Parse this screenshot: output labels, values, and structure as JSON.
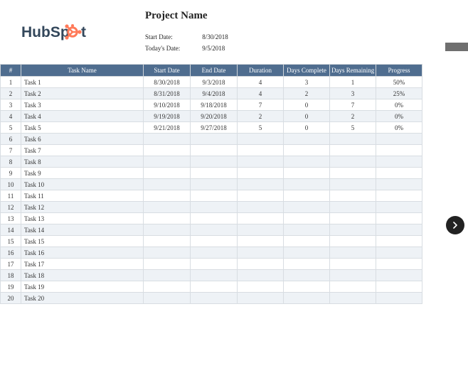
{
  "logo": {
    "text_primary": "HubSp",
    "text_secondary": "t"
  },
  "project": {
    "title": "Project Name",
    "start_date_label": "Start Date:",
    "start_date_value": "8/30/2018",
    "today_label": "Today's Date:",
    "today_value": "9/5/2018"
  },
  "table": {
    "headers": {
      "num": "#",
      "name": "Task Name",
      "start": "Start Date",
      "end": "End Date",
      "duration": "Duration",
      "days_complete": "Days Complete",
      "days_remaining": "Days Remaining",
      "progress": "Progress"
    },
    "rows": [
      {
        "n": "1",
        "name": "Task 1",
        "start": "8/30/2018",
        "end": "9/3/2018",
        "dur": "4",
        "dc": "3",
        "dr": "1",
        "prog": "50%"
      },
      {
        "n": "2",
        "name": "Task 2",
        "start": "8/31/2018",
        "end": "9/4/2018",
        "dur": "4",
        "dc": "2",
        "dr": "3",
        "prog": "25%"
      },
      {
        "n": "3",
        "name": "Task 3",
        "start": "9/10/2018",
        "end": "9/18/2018",
        "dur": "7",
        "dc": "0",
        "dr": "7",
        "prog": "0%"
      },
      {
        "n": "4",
        "name": "Task 4",
        "start": "9/19/2018",
        "end": "9/20/2018",
        "dur": "2",
        "dc": "0",
        "dr": "2",
        "prog": "0%"
      },
      {
        "n": "5",
        "name": "Task 5",
        "start": "9/21/2018",
        "end": "9/27/2018",
        "dur": "5",
        "dc": "0",
        "dr": "5",
        "prog": "0%"
      },
      {
        "n": "6",
        "name": "Task 6",
        "start": "",
        "end": "",
        "dur": "",
        "dc": "",
        "dr": "",
        "prog": ""
      },
      {
        "n": "7",
        "name": "Task 7",
        "start": "",
        "end": "",
        "dur": "",
        "dc": "",
        "dr": "",
        "prog": ""
      },
      {
        "n": "8",
        "name": "Task 8",
        "start": "",
        "end": "",
        "dur": "",
        "dc": "",
        "dr": "",
        "prog": ""
      },
      {
        "n": "9",
        "name": "Task 9",
        "start": "",
        "end": "",
        "dur": "",
        "dc": "",
        "dr": "",
        "prog": ""
      },
      {
        "n": "10",
        "name": "Task 10",
        "start": "",
        "end": "",
        "dur": "",
        "dc": "",
        "dr": "",
        "prog": ""
      },
      {
        "n": "11",
        "name": "Task 11",
        "start": "",
        "end": "",
        "dur": "",
        "dc": "",
        "dr": "",
        "prog": ""
      },
      {
        "n": "12",
        "name": "Task 12",
        "start": "",
        "end": "",
        "dur": "",
        "dc": "",
        "dr": "",
        "prog": ""
      },
      {
        "n": "13",
        "name": "Task 13",
        "start": "",
        "end": "",
        "dur": "",
        "dc": "",
        "dr": "",
        "prog": ""
      },
      {
        "n": "14",
        "name": "Task 14",
        "start": "",
        "end": "",
        "dur": "",
        "dc": "",
        "dr": "",
        "prog": ""
      },
      {
        "n": "15",
        "name": "Task 15",
        "start": "",
        "end": "",
        "dur": "",
        "dc": "",
        "dr": "",
        "prog": ""
      },
      {
        "n": "16",
        "name": "Task 16",
        "start": "",
        "end": "",
        "dur": "",
        "dc": "",
        "dr": "",
        "prog": ""
      },
      {
        "n": "17",
        "name": "Task 17",
        "start": "",
        "end": "",
        "dur": "",
        "dc": "",
        "dr": "",
        "prog": ""
      },
      {
        "n": "18",
        "name": "Task 18",
        "start": "",
        "end": "",
        "dur": "",
        "dc": "",
        "dr": "",
        "prog": ""
      },
      {
        "n": "19",
        "name": "Task 19",
        "start": "",
        "end": "",
        "dur": "",
        "dc": "",
        "dr": "",
        "prog": ""
      },
      {
        "n": "20",
        "name": "Task 20",
        "start": "",
        "end": "",
        "dur": "",
        "dc": "",
        "dr": "",
        "prog": ""
      }
    ]
  }
}
